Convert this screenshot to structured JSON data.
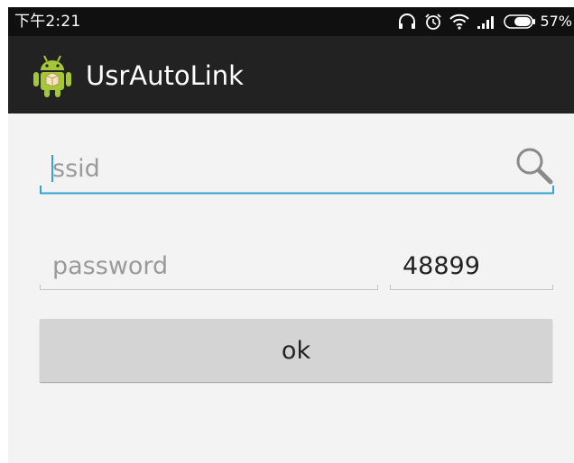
{
  "status_bar": {
    "time": "下午2:21",
    "battery_percent": "57%",
    "icons": [
      "headphones-icon",
      "alarm-icon",
      "wifi-icon",
      "signal-icon",
      "battery-icon"
    ]
  },
  "action_bar": {
    "app_icon": "android-icon",
    "title": "UsrAutoLink"
  },
  "form": {
    "ssid_placeholder": "ssid",
    "ssid_value": "",
    "password_placeholder": "password",
    "password_value": "",
    "port_value": "48899",
    "ok_label": "ok"
  },
  "colors": {
    "status_bar": "#101010",
    "action_bar": "#222222",
    "background": "#f3f3f3",
    "focus_accent": "#33a3d0",
    "button": "#d4d4d4"
  }
}
